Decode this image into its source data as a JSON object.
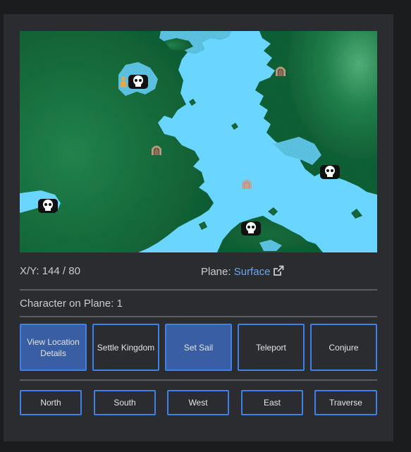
{
  "coordinates": {
    "label": "X/Y:",
    "value": "144 / 80"
  },
  "plane": {
    "label": "Plane:",
    "name": "Surface",
    "link_icon": "external-link-icon"
  },
  "characters": {
    "label": "Character on Plane:",
    "count": "1"
  },
  "actions": [
    {
      "label": "View Location Details",
      "active": true
    },
    {
      "label": "Settle Kingdom",
      "active": false
    },
    {
      "label": "Set Sail",
      "active": true
    },
    {
      "label": "Teleport",
      "active": false
    },
    {
      "label": "Conjure",
      "active": false
    }
  ],
  "movement": [
    {
      "label": "North"
    },
    {
      "label": "South"
    },
    {
      "label": "West"
    },
    {
      "label": "East"
    },
    {
      "label": "Traverse"
    }
  ],
  "map": {
    "water_color": "#6ad6ff",
    "land_color": "#1e6b3c",
    "markers": [
      {
        "type": "player-character",
        "icon": "character-icon"
      },
      {
        "type": "enemy-location",
        "icon": "skull-icon"
      },
      {
        "type": "enemy-location",
        "icon": "skull-icon"
      },
      {
        "type": "enemy-location",
        "icon": "skull-icon"
      },
      {
        "type": "enemy-location",
        "icon": "skull-icon"
      },
      {
        "type": "port",
        "icon": "gate-icon"
      },
      {
        "type": "port",
        "icon": "gate-icon"
      },
      {
        "type": "port",
        "icon": "gate-icon"
      }
    ]
  }
}
